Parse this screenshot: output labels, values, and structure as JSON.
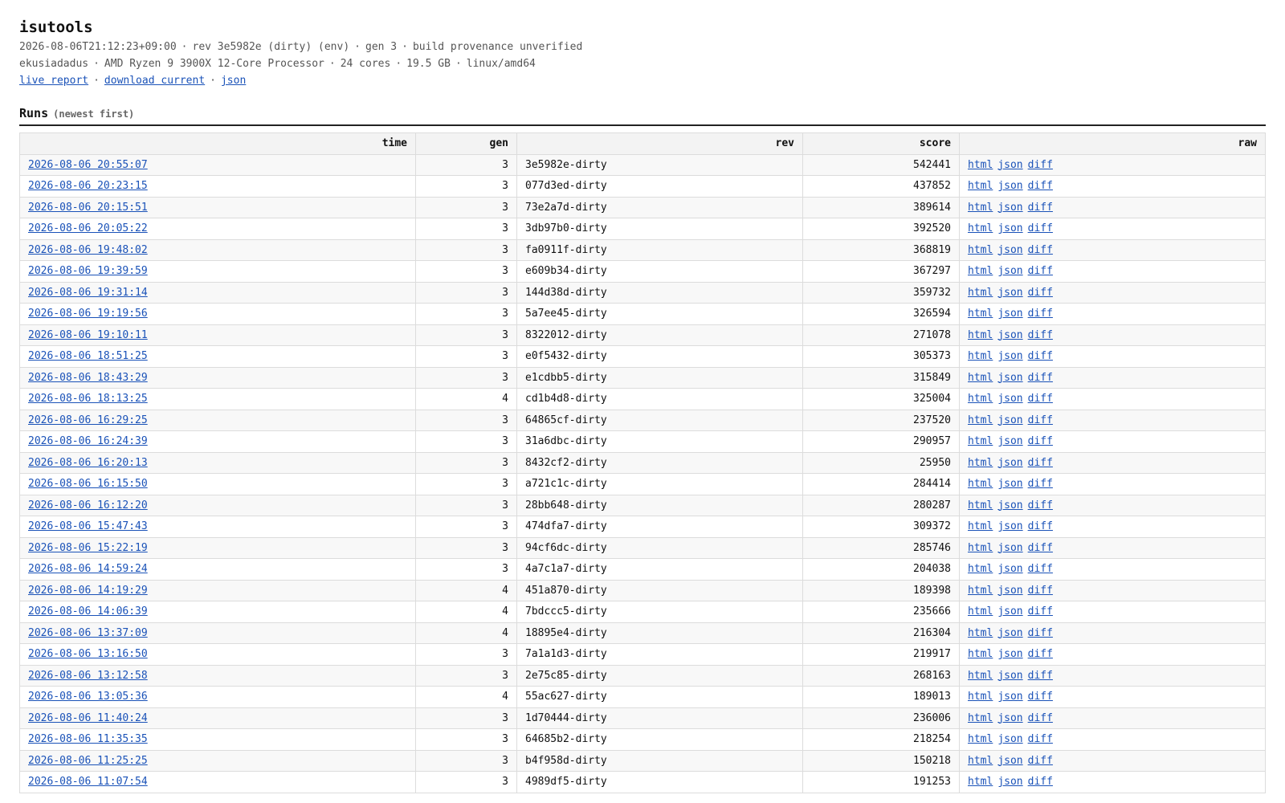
{
  "title": "isutools",
  "meta_line1": [
    "2026-08-06T21:12:23+09:00",
    "rev 3e5982e (dirty) (env)",
    "gen 3",
    "build provenance unverified"
  ],
  "meta_line2": [
    "ekusiadadus",
    "AMD Ryzen 9 3900X 12-Core Processor",
    "24 cores",
    "19.5 GB",
    "linux/amd64"
  ],
  "separator": "·",
  "links": [
    "live report",
    "download current",
    "json"
  ],
  "runs": {
    "title": "Runs",
    "subtitle": "(newest first)",
    "columns": [
      "time",
      "gen",
      "rev",
      "score",
      "raw"
    ],
    "raw_links": [
      "html",
      "json",
      "diff"
    ],
    "rows": [
      {
        "time": "2026-08-06 20:55:07",
        "gen": "3",
        "rev": "3e5982e-dirty",
        "score": "542441"
      },
      {
        "time": "2026-08-06 20:23:15",
        "gen": "3",
        "rev": "077d3ed-dirty",
        "score": "437852"
      },
      {
        "time": "2026-08-06 20:15:51",
        "gen": "3",
        "rev": "73e2a7d-dirty",
        "score": "389614"
      },
      {
        "time": "2026-08-06 20:05:22",
        "gen": "3",
        "rev": "3db97b0-dirty",
        "score": "392520"
      },
      {
        "time": "2026-08-06 19:48:02",
        "gen": "3",
        "rev": "fa0911f-dirty",
        "score": "368819"
      },
      {
        "time": "2026-08-06 19:39:59",
        "gen": "3",
        "rev": "e609b34-dirty",
        "score": "367297"
      },
      {
        "time": "2026-08-06 19:31:14",
        "gen": "3",
        "rev": "144d38d-dirty",
        "score": "359732"
      },
      {
        "time": "2026-08-06 19:19:56",
        "gen": "3",
        "rev": "5a7ee45-dirty",
        "score": "326594"
      },
      {
        "time": "2026-08-06 19:10:11",
        "gen": "3",
        "rev": "8322012-dirty",
        "score": "271078"
      },
      {
        "time": "2026-08-06 18:51:25",
        "gen": "3",
        "rev": "e0f5432-dirty",
        "score": "305373"
      },
      {
        "time": "2026-08-06 18:43:29",
        "gen": "3",
        "rev": "e1cdbb5-dirty",
        "score": "315849"
      },
      {
        "time": "2026-08-06 18:13:25",
        "gen": "4",
        "rev": "cd1b4d8-dirty",
        "score": "325004"
      },
      {
        "time": "2026-08-06 16:29:25",
        "gen": "3",
        "rev": "64865cf-dirty",
        "score": "237520"
      },
      {
        "time": "2026-08-06 16:24:39",
        "gen": "3",
        "rev": "31a6dbc-dirty",
        "score": "290957"
      },
      {
        "time": "2026-08-06 16:20:13",
        "gen": "3",
        "rev": "8432cf2-dirty",
        "score": "25950"
      },
      {
        "time": "2026-08-06 16:15:50",
        "gen": "3",
        "rev": "a721c1c-dirty",
        "score": "284414"
      },
      {
        "time": "2026-08-06 16:12:20",
        "gen": "3",
        "rev": "28bb648-dirty",
        "score": "280287"
      },
      {
        "time": "2026-08-06 15:47:43",
        "gen": "3",
        "rev": "474dfa7-dirty",
        "score": "309372"
      },
      {
        "time": "2026-08-06 15:22:19",
        "gen": "3",
        "rev": "94cf6dc-dirty",
        "score": "285746"
      },
      {
        "time": "2026-08-06 14:59:24",
        "gen": "3",
        "rev": "4a7c1a7-dirty",
        "score": "204038"
      },
      {
        "time": "2026-08-06 14:19:29",
        "gen": "4",
        "rev": "451a870-dirty",
        "score": "189398"
      },
      {
        "time": "2026-08-06 14:06:39",
        "gen": "4",
        "rev": "7bdccc5-dirty",
        "score": "235666"
      },
      {
        "time": "2026-08-06 13:37:09",
        "gen": "4",
        "rev": "18895e4-dirty",
        "score": "216304"
      },
      {
        "time": "2026-08-06 13:16:50",
        "gen": "3",
        "rev": "7a1a1d3-dirty",
        "score": "219917"
      },
      {
        "time": "2026-08-06 13:12:58",
        "gen": "3",
        "rev": "2e75c85-dirty",
        "score": "268163"
      },
      {
        "time": "2026-08-06 13:05:36",
        "gen": "4",
        "rev": "55ac627-dirty",
        "score": "189013"
      },
      {
        "time": "2026-08-06 11:40:24",
        "gen": "3",
        "rev": "1d70444-dirty",
        "score": "236006"
      },
      {
        "time": "2026-08-06 11:35:35",
        "gen": "3",
        "rev": "64685b2-dirty",
        "score": "218254"
      },
      {
        "time": "2026-08-06 11:25:25",
        "gen": "3",
        "rev": "b4f958d-dirty",
        "score": "150218"
      },
      {
        "time": "2026-08-06 11:07:54",
        "gen": "3",
        "rev": "4989df5-dirty",
        "score": "191253"
      }
    ]
  }
}
